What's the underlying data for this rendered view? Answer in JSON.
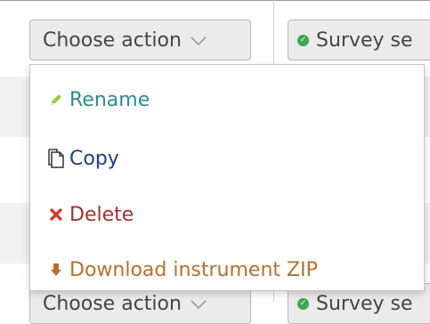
{
  "toolbar": {
    "choose_action_label": "Choose action",
    "survey_button_label": "Survey se",
    "bottom_choose_action_label": "Choose action",
    "bottom_survey_button_label": "Survey se"
  },
  "menu": {
    "items": [
      {
        "label": "Rename",
        "icon": "pencil-icon",
        "color": "#2f8a8a"
      },
      {
        "label": "Copy",
        "icon": "copy-icon",
        "color": "#1f3e7a"
      },
      {
        "label": "Delete",
        "icon": "delete-x-icon",
        "color": "#a33030"
      },
      {
        "label": "Download instrument ZIP",
        "icon": "download-arrow-icon",
        "color": "#b5702e"
      }
    ]
  },
  "colors": {
    "button_bg": "#ebebeb",
    "button_border": "#b9b9b9",
    "row_stripe": "#f1f1f1",
    "success_green": "#3ea84b"
  }
}
